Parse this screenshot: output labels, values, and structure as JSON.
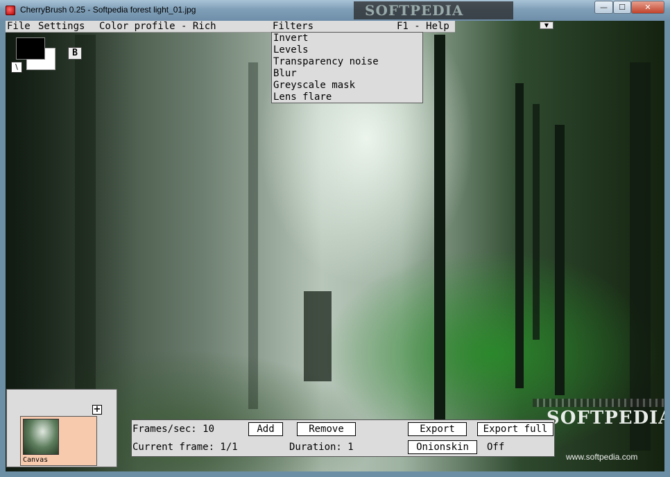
{
  "window": {
    "title": "CherryBrush 0.25 - Softpedia forest light_01.jpg",
    "watermark_title": "SOFTPEDIA",
    "controls": {
      "minimize": "—",
      "maximize": "☐",
      "close": "✕"
    }
  },
  "menubar": {
    "file": "File",
    "settings": "Settings",
    "color_profile": "Color profile - Rich",
    "filters": "Filters",
    "help": "F1 - Help",
    "collapse_arrow": "▼"
  },
  "filters_menu": [
    "Invert",
    "Levels",
    "Transparency noise",
    "Blur",
    "Greyscale mask",
    "Lens flare"
  ],
  "tools": {
    "brush_toggle": "\\",
    "b_button": "B",
    "foreground_color": "#000000",
    "background_color": "#ffffff"
  },
  "frames_panel": {
    "add_frame": "+",
    "frame_label": "Canvas"
  },
  "animation": {
    "fps_label": "Frames/sec: 10",
    "add": "Add",
    "remove": "Remove",
    "export": "Export",
    "export_full": "Export full",
    "current_frame": "Current frame: 1/1",
    "duration": "Duration: 1",
    "onionskin": "Onionskin",
    "onionskin_state": "Off"
  },
  "canvas_watermark": {
    "brand": "SOFTPEDIA",
    "url": "www.softpedia.com"
  },
  "colors": {
    "panel_bg": "#dcdcdc",
    "frame_bg": "#f7c9ad",
    "titlebar": "#7f9fb8"
  }
}
